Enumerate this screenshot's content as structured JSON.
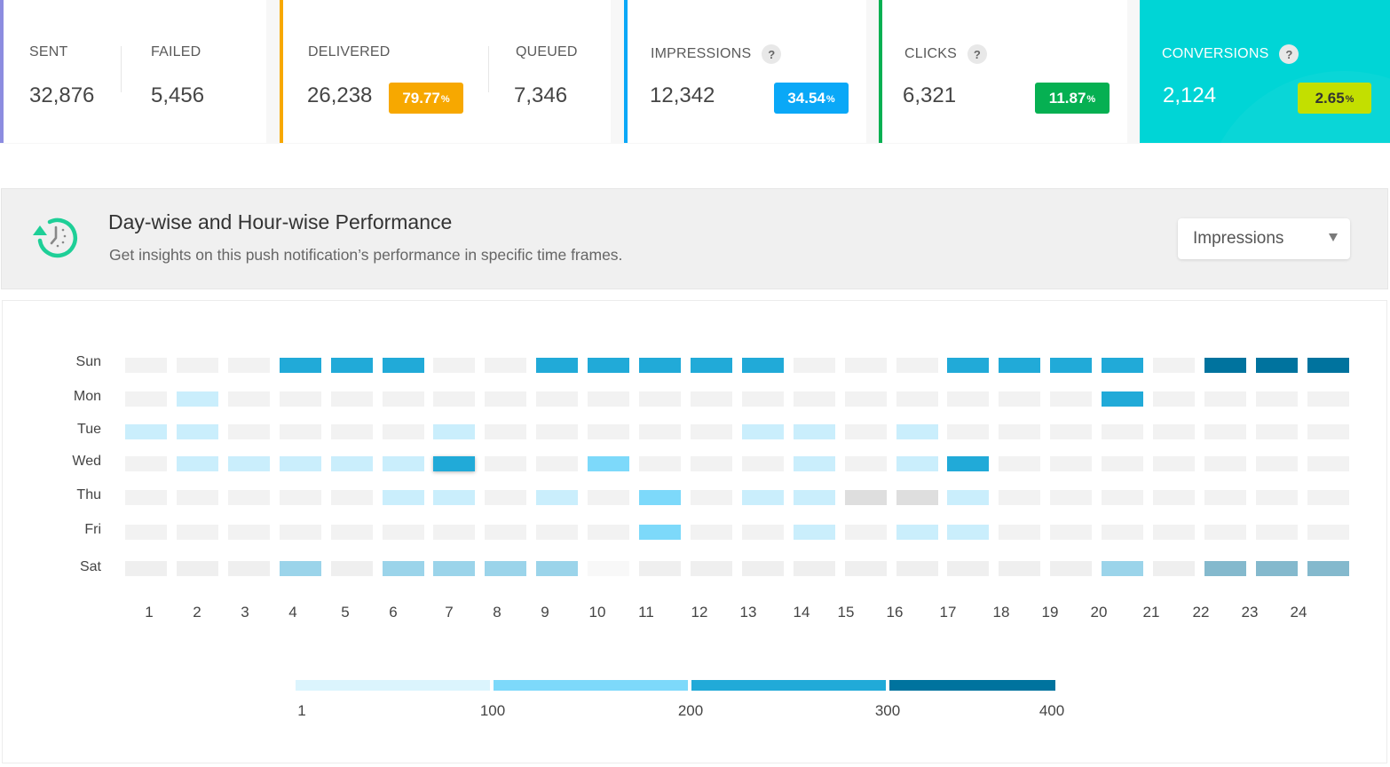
{
  "stats": {
    "sent": {
      "label": "SENT",
      "value": "32,876"
    },
    "failed": {
      "label": "FAILED",
      "value": "5,456"
    },
    "delivered": {
      "label": "DELIVERED",
      "value": "26,238",
      "badge": "79.77",
      "badge_unit": "%",
      "color": "#f7a800"
    },
    "queued": {
      "label": "QUEUED",
      "value": "7,346"
    },
    "impressions": {
      "label": "IMPRESSIONS",
      "value": "12,342",
      "badge": "34.54",
      "badge_unit": "%",
      "color": "#0aa8f7",
      "help": "?"
    },
    "clicks": {
      "label": "CLICKS",
      "value": "6,321",
      "badge": "11.87",
      "badge_unit": "%",
      "color": "#06b052",
      "help": "?"
    },
    "conversions": {
      "label": "CONVERSIONS",
      "value": "2,124",
      "badge": "2.65",
      "badge_unit": "%",
      "color": "#00d5d6",
      "badge_color": "#c3df00",
      "help": "?"
    },
    "accent_sent": "#8c8ce0"
  },
  "section": {
    "icon": "clock-refresh-icon",
    "title": "Day-wise and Hour-wise Performance",
    "subtitle": "Get insights on this push notification’s performance in specific time frames.",
    "metric_select": {
      "selected": "Impressions"
    }
  },
  "chart_data": {
    "type": "heatmap",
    "title": "Day-wise and Hour-wise Performance",
    "metric": "Impressions",
    "rows": [
      "Sun",
      "Mon",
      "Tue",
      "Wed",
      "Thu",
      "Fri",
      "Sat"
    ],
    "columns": [
      "1",
      "2",
      "3",
      "4",
      "5",
      "6",
      "7",
      "8",
      "9",
      "10",
      "11",
      "12",
      "13",
      "14",
      "15",
      "16",
      "17",
      "18",
      "19",
      "20",
      "21",
      "22",
      "23",
      "24"
    ],
    "levels_legend": "0=none, 1=1-100, 2=100-200, 3=200-300, 4=300-400, g=gray(no data), s=Sat light-muted, d=Sat dark-muted, f=faint, e=Sat empty",
    "values": [
      [
        "0",
        "0",
        "0",
        "3",
        "3",
        "3",
        "0",
        "0",
        "3",
        "3",
        "3",
        "3",
        "3",
        "0",
        "0",
        "0",
        "3",
        "3",
        "3",
        "3",
        "0",
        "4",
        "4",
        "4"
      ],
      [
        "0",
        "1",
        "0",
        "0",
        "0",
        "0",
        "0",
        "0",
        "0",
        "0",
        "0",
        "0",
        "0",
        "0",
        "0",
        "0",
        "0",
        "0",
        "0",
        "3",
        "0",
        "0",
        "0",
        "0"
      ],
      [
        "1",
        "1",
        "0",
        "0",
        "0",
        "0",
        "1",
        "0",
        "0",
        "0",
        "0",
        "0",
        "1",
        "1",
        "0",
        "1",
        "0",
        "0",
        "0",
        "0",
        "0",
        "0",
        "0",
        "0"
      ],
      [
        "0",
        "1",
        "1",
        "1",
        "1",
        "1",
        "3",
        "0",
        "0",
        "2",
        "0",
        "0",
        "0",
        "1",
        "0",
        "1",
        "3",
        "0",
        "0",
        "0",
        "0",
        "0",
        "0",
        "0"
      ],
      [
        "0",
        "0",
        "0",
        "0",
        "0",
        "1",
        "1",
        "0",
        "1",
        "0",
        "2",
        "0",
        "1",
        "1",
        "g",
        "g",
        "1",
        "0",
        "0",
        "0",
        "0",
        "0",
        "0",
        "0"
      ],
      [
        "0",
        "0",
        "0",
        "0",
        "0",
        "0",
        "0",
        "0",
        "0",
        "0",
        "2",
        "0",
        "0",
        "1",
        "0",
        "1",
        "1",
        "0",
        "0",
        "0",
        "0",
        "0",
        "0",
        "0"
      ],
      [
        "e",
        "e",
        "e",
        "s",
        "e",
        "s",
        "s",
        "s",
        "s",
        "f",
        "e",
        "e",
        "e",
        "e",
        "e",
        "e",
        "e",
        "e",
        "e",
        "s",
        "e",
        "d",
        "d",
        "d"
      ]
    ],
    "highlighted_cell": {
      "row": "Wed",
      "column": "7"
    },
    "colors": {
      "0": "#f2f2f2",
      "1": "#caeefc",
      "2": "#7dd9fa",
      "3": "#21aad8",
      "4": "#00739e",
      "g": "#dedede",
      "s": "#9bd4ea",
      "d": "#84b9cd",
      "f": "#f8f8f8",
      "e": "#efefef"
    },
    "legend": {
      "ticks": [
        "1",
        "100",
        "200",
        "300",
        "400"
      ],
      "segments": [
        {
          "from": 1,
          "to": 100,
          "color": "#dbf4fd"
        },
        {
          "from": 100,
          "to": 200,
          "color": "#7dd9fa"
        },
        {
          "from": 200,
          "to": 300,
          "color": "#21aad8"
        },
        {
          "from": 300,
          "to": 400,
          "color": "#00739e"
        }
      ],
      "position": "bottom-center"
    }
  }
}
